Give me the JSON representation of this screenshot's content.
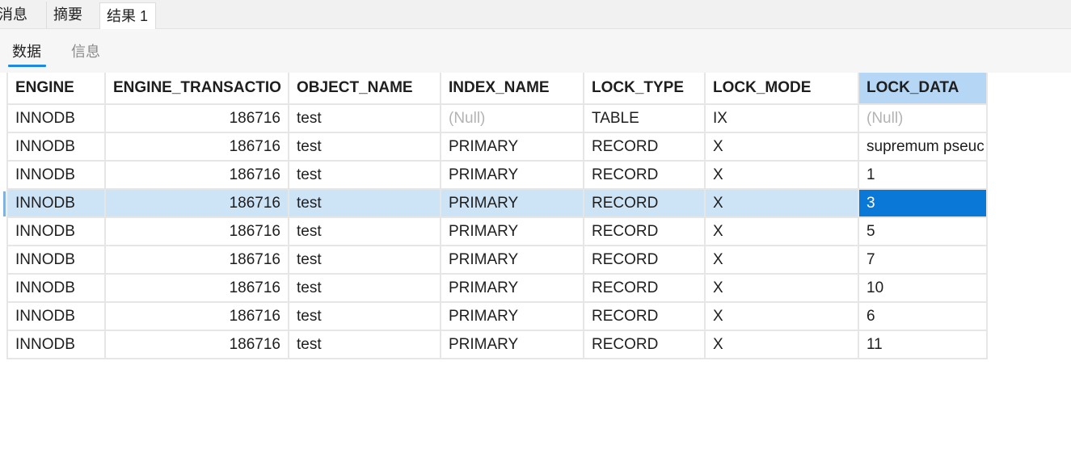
{
  "result_tabs": [
    {
      "label": "消息"
    },
    {
      "label": "摘要"
    },
    {
      "label": "结果 1",
      "active": true
    }
  ],
  "sub_tabs": [
    {
      "label": "数据",
      "active": true
    },
    {
      "label": "信息"
    }
  ],
  "table": {
    "columns": [
      "ENGINE",
      "ENGINE_TRANSACTIO",
      "OBJECT_NAME",
      "INDEX_NAME",
      "LOCK_TYPE",
      "LOCK_MODE",
      "LOCK_DATA"
    ],
    "rows": [
      [
        "INNODB",
        "186716",
        "test",
        "(Null)",
        "TABLE",
        "IX",
        "(Null)"
      ],
      [
        "INNODB",
        "186716",
        "test",
        "PRIMARY",
        "RECORD",
        "X",
        "supremum pseuc"
      ],
      [
        "INNODB",
        "186716",
        "test",
        "PRIMARY",
        "RECORD",
        "X",
        "1"
      ],
      [
        "INNODB",
        "186716",
        "test",
        "PRIMARY",
        "RECORD",
        "X",
        "3"
      ],
      [
        "INNODB",
        "186716",
        "test",
        "PRIMARY",
        "RECORD",
        "X",
        "5"
      ],
      [
        "INNODB",
        "186716",
        "test",
        "PRIMARY",
        "RECORD",
        "X",
        "7"
      ],
      [
        "INNODB",
        "186716",
        "test",
        "PRIMARY",
        "RECORD",
        "X",
        "10"
      ],
      [
        "INNODB",
        "186716",
        "test",
        "PRIMARY",
        "RECORD",
        "X",
        "6"
      ],
      [
        "INNODB",
        "186716",
        "test",
        "PRIMARY",
        "RECORD",
        "X",
        "11"
      ]
    ],
    "selected_row": 3,
    "active_column": 6
  },
  "colors": {
    "accent": "#1e88e5",
    "selected_row_bg": "#cde4f7",
    "active_cell_bg": "#0a78d7",
    "sorted_header_bg": "#b5d6f4"
  }
}
